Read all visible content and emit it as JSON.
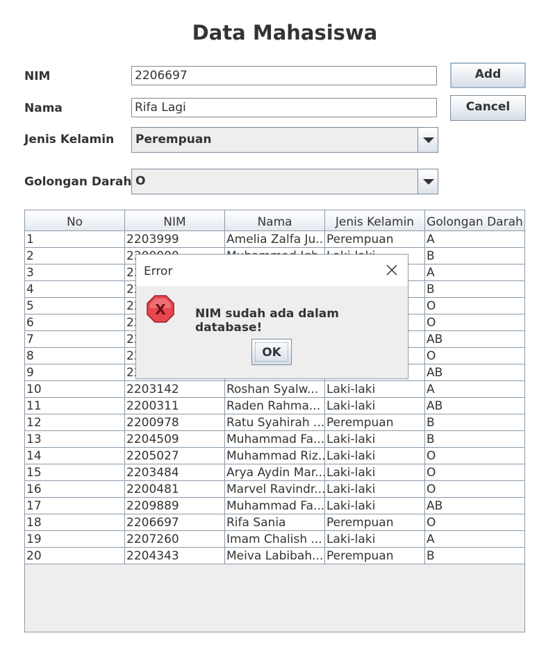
{
  "title": "Data Mahasiswa",
  "form": {
    "nim_label": "NIM",
    "nim_value": "2206697",
    "nama_label": "Nama",
    "nama_value": "Rifa Lagi",
    "jenis_kelamin_label": "Jenis Kelamin",
    "jenis_kelamin_value": "Perempuan",
    "golongan_darah_label": "Golongan Darah",
    "golongan_darah_value": "O"
  },
  "buttons": {
    "add_label": "Add",
    "cancel_label": "Cancel"
  },
  "table": {
    "columns": [
      "No",
      "NIM",
      "Nama",
      "Jenis Kelamin",
      "Golongan Darah"
    ],
    "rows": [
      [
        "1",
        "2203999",
        "Amelia Zalfa Ju...",
        "Perempuan",
        "A"
      ],
      [
        "2",
        "2200000",
        "Muhammad Iqb...",
        "Laki-laki",
        "B"
      ],
      [
        "3",
        "2200000",
        "",
        "",
        "A"
      ],
      [
        "4",
        "2200000",
        "",
        "",
        "B"
      ],
      [
        "5",
        "2200000",
        "",
        "",
        "O"
      ],
      [
        "6",
        "2200000",
        "",
        "",
        "O"
      ],
      [
        "7",
        "2200000",
        "",
        "",
        "AB"
      ],
      [
        "8",
        "2200000",
        "",
        "",
        "O"
      ],
      [
        "9",
        "2200000",
        "",
        "",
        "AB"
      ],
      [
        "10",
        "2203142",
        "Roshan Syalw...",
        "Laki-laki",
        "A"
      ],
      [
        "11",
        "2200311",
        "Raden Rahma...",
        "Laki-laki",
        "AB"
      ],
      [
        "12",
        "2200978",
        "Ratu Syahirah ...",
        "Perempuan",
        "B"
      ],
      [
        "13",
        "2204509",
        "Muhammad Fa...",
        "Laki-laki",
        "B"
      ],
      [
        "14",
        "2205027",
        "Muhammad Riz...",
        "Laki-laki",
        "O"
      ],
      [
        "15",
        "2203484",
        "Arya Aydin Mar...",
        "Laki-laki",
        "O"
      ],
      [
        "16",
        "2200481",
        "Marvel Ravindr...",
        "Laki-laki",
        "O"
      ],
      [
        "17",
        "2209889",
        "Muhammad Fa...",
        "Laki-laki",
        "AB"
      ],
      [
        "18",
        "2206697",
        "Rifa Sania",
        "Perempuan",
        "O"
      ],
      [
        "19",
        "2207260",
        "Imam Chalish ...",
        "Laki-laki",
        "A"
      ],
      [
        "20",
        "2204343",
        "Meiva Labibah...",
        "Perempuan",
        "B"
      ]
    ]
  },
  "dialog": {
    "title": "Error",
    "message": "NIM sudah ada dalam database!",
    "ok_label": "OK",
    "icon": "error-icon",
    "close_icon": "close-icon"
  },
  "colors": {
    "error_red": "#d9323a",
    "border": "#7a8a99",
    "dialog_bg": "#eeeeee"
  }
}
